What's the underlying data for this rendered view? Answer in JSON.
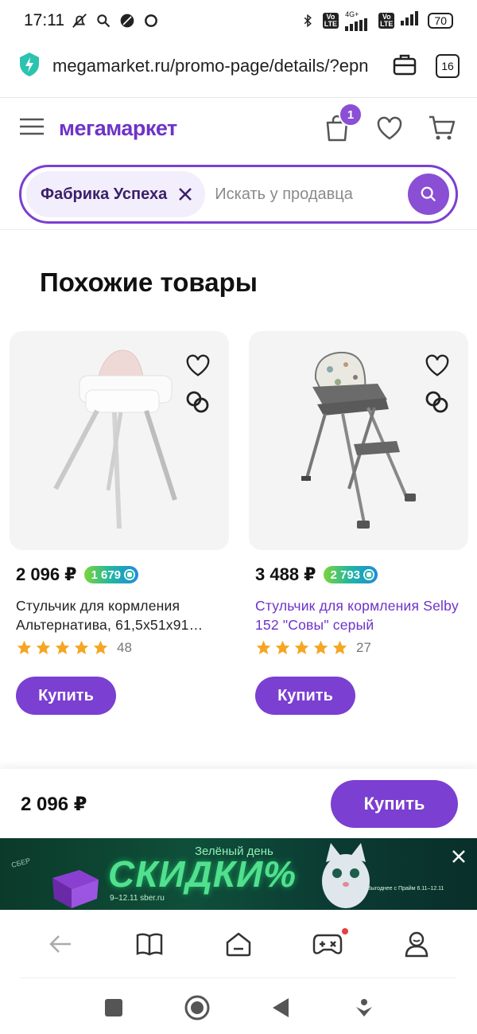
{
  "status_bar": {
    "time": "17:11",
    "volte_1": "Vo\nLTE",
    "network_label": "4G+",
    "volte_2": "Vo\nLTE",
    "battery": "70"
  },
  "browser": {
    "url": "megamarket.ru/promo-page/details/?epn",
    "tab_count": "16"
  },
  "header": {
    "logo": "мегамаркет",
    "orders_badge": "1"
  },
  "search": {
    "seller_chip": "Фабрика Успеха",
    "placeholder": "Искать у продавца"
  },
  "section": {
    "title": "Похожие товары"
  },
  "products": [
    {
      "price": "2 096 ₽",
      "bonus": "1 679",
      "name": "Стульчик для кормления Альтернатива, 61,5х51х91…",
      "rating": 5,
      "reviews": "48",
      "buy_label": "Купить"
    },
    {
      "price": "3 488 ₽",
      "bonus": "2 793",
      "name": "Стульчик для кормления Selby 152 \"Совы\" серый",
      "rating": 5,
      "reviews": "27",
      "buy_label": "Купить"
    }
  ],
  "sticky_bar": {
    "price": "2 096 ₽",
    "buy_label": "Купить"
  },
  "promo": {
    "main_text": "СКИДКИ%",
    "sub_text": "Зелёный день",
    "dates": "9–12.11   sber.ru",
    "small_text": "Выгоднее  с Прайм  6.11–12.11",
    "brand": "СБЕР"
  },
  "colors": {
    "brand_purple": "#7b3fd1",
    "star_orange": "#f5a623"
  },
  "icons": {
    "url_shield": "shield-lightning-icon",
    "menu": "hamburger-menu-icon",
    "orders": "shopping-bag-icon",
    "favorites": "heart-icon",
    "cart": "cart-icon",
    "search": "search-icon",
    "chip_close": "close-icon",
    "compare": "compare-icon"
  }
}
